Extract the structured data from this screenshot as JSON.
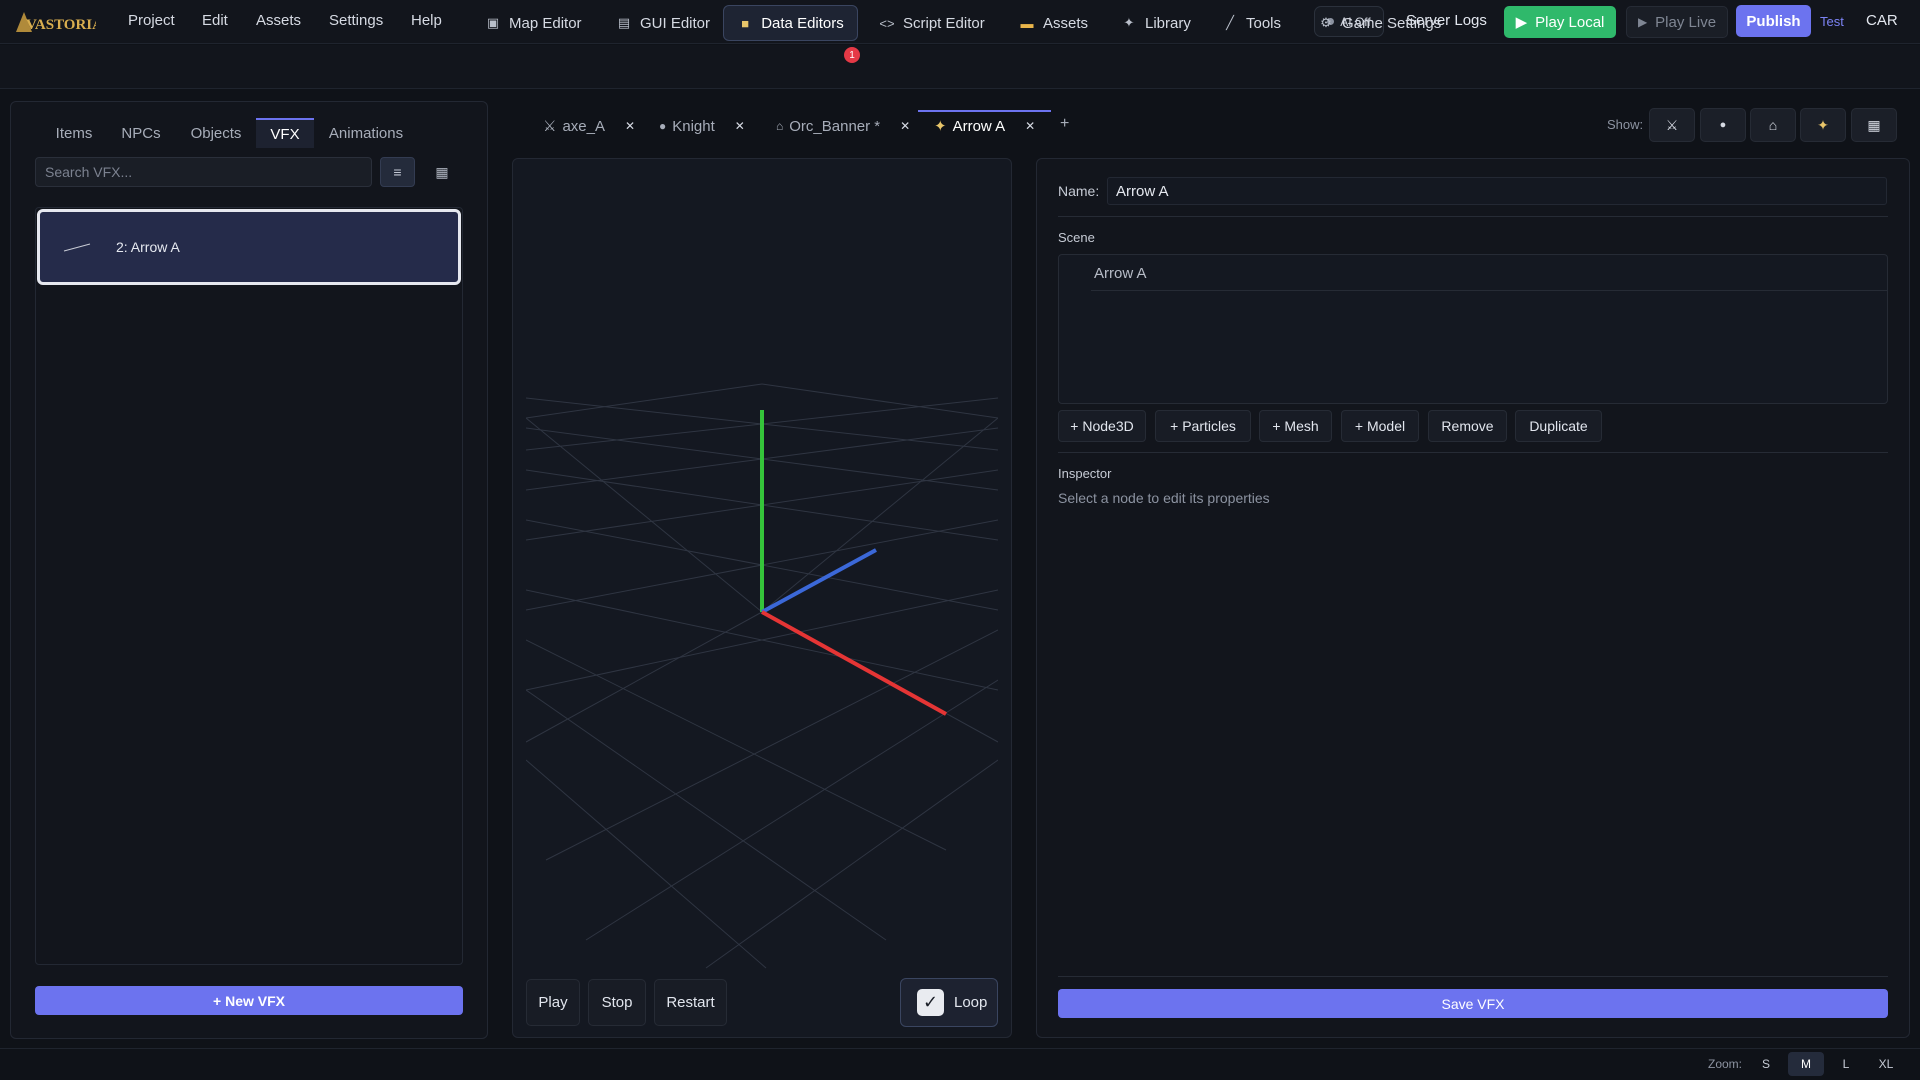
{
  "app": {
    "logo_text": "VASTORIA",
    "menu": [
      "Project",
      "Edit",
      "Assets",
      "Settings",
      "Help"
    ],
    "ai_toggle": "AI Off",
    "server_logs": "Server Logs",
    "play_local": "Play Local",
    "play_live": "Play Live",
    "publish": "Publish",
    "test": "Test",
    "user": "CAR"
  },
  "nav": {
    "tabs": [
      {
        "label": "Map Editor",
        "icon": "map-icon"
      },
      {
        "label": "GUI Editor",
        "icon": "gui-icon"
      },
      {
        "label": "Data Editors",
        "icon": "database-icon",
        "badge": "1",
        "active": true
      },
      {
        "label": "Script Editor",
        "icon": "code-icon"
      },
      {
        "label": "Assets",
        "icon": "folder-icon"
      },
      {
        "label": "Library",
        "icon": "sparkle-icon"
      },
      {
        "label": "Tools",
        "icon": "wand-icon"
      },
      {
        "label": "Game Settings",
        "icon": "gear-icon"
      }
    ]
  },
  "left": {
    "categories": [
      "Items",
      "NPCs",
      "Objects",
      "VFX",
      "Animations"
    ],
    "active_category": "VFX",
    "search_placeholder": "Search VFX...",
    "items": [
      {
        "label": "2: Arrow A"
      }
    ],
    "new_button": "+ New VFX"
  },
  "editor": {
    "tabs": [
      {
        "label": "axe_A",
        "icon": "swords-icon"
      },
      {
        "label": "Knight",
        "icon": "person-icon"
      },
      {
        "label": "Orc_Banner *",
        "icon": "house-icon"
      },
      {
        "label": "Arrow A",
        "icon": "sparkle-icon",
        "active": true
      }
    ],
    "add_tab": "+",
    "show_label": "Show:",
    "show_filters": [
      "swords-icon",
      "person-icon",
      "house-icon",
      "sparkle-icon",
      "film-icon"
    ]
  },
  "viewport": {
    "play": "Play",
    "stop": "Stop",
    "restart": "Restart",
    "loop": "Loop",
    "loop_checked": true,
    "axis_colors": {
      "x": "#e53535",
      "y": "#35c43a",
      "z": "#3b68d8"
    }
  },
  "inspector": {
    "name_label": "Name:",
    "name_value": "Arrow A",
    "scene_label": "Scene",
    "scene_nodes": [
      "Arrow A"
    ],
    "actions": [
      "+ Node3D",
      "+ Particles",
      "+ Mesh",
      "+ Model",
      "Remove",
      "Duplicate"
    ],
    "inspector_label": "Inspector",
    "inspector_empty": "Select a node to edit its properties",
    "save": "Save VFX"
  },
  "footer": {
    "zoom_label": "Zoom:",
    "zoom_options": [
      "S",
      "M",
      "L",
      "XL"
    ],
    "zoom_selected": "M"
  },
  "colors": {
    "accent": "#6c73ef",
    "play_green": "#2fb96b",
    "badge_red": "#e53946"
  }
}
